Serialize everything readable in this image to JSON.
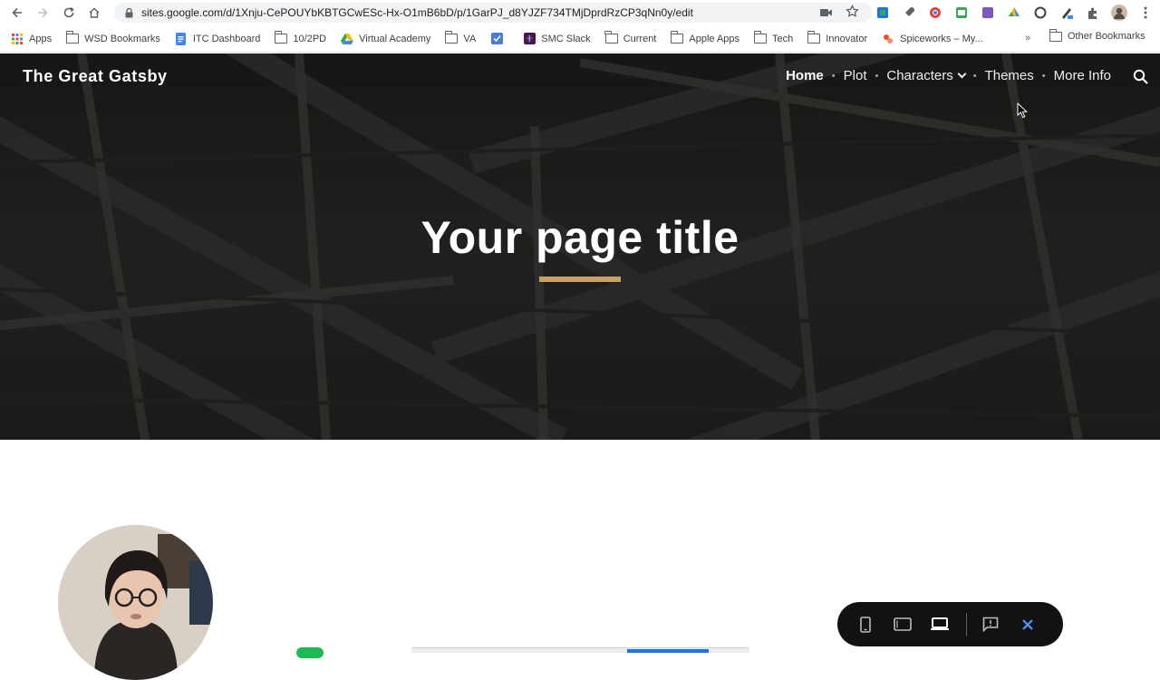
{
  "browser": {
    "url": "sites.google.com/d/1Xnju-CePOUYbKBTGCwESc-Hx-O1mB6bD/p/1GarPJ_d8YJZF734TMjDprdRzCP3qNn0y/edit",
    "bookmarks": [
      {
        "label": "Apps",
        "icon": "apps-grid-icon"
      },
      {
        "label": "WSD Bookmarks",
        "icon": "folder-icon"
      },
      {
        "label": "ITC Dashboard",
        "icon": "docs-icon"
      },
      {
        "label": "10/2PD",
        "icon": "folder-icon"
      },
      {
        "label": "Virtual Academy",
        "icon": "drive-icon"
      },
      {
        "label": "VA",
        "icon": "folder-icon"
      },
      {
        "label": "",
        "icon": "tasks-icon"
      },
      {
        "label": "SMC Slack",
        "icon": "slack-icon"
      },
      {
        "label": "Current",
        "icon": "folder-icon"
      },
      {
        "label": "Apple Apps",
        "icon": "folder-icon"
      },
      {
        "label": "Tech",
        "icon": "folder-icon"
      },
      {
        "label": "Innovator",
        "icon": "folder-icon"
      },
      {
        "label": "Spiceworks – My...",
        "icon": "spiceworks-icon"
      }
    ],
    "more_bookmarks": "»",
    "other_bookmarks": "Other Bookmarks"
  },
  "site": {
    "title": "The Great Gatsby",
    "nav": [
      {
        "label": "Home",
        "active": true
      },
      {
        "label": "Plot"
      },
      {
        "label": "Characters",
        "has_dropdown": true
      },
      {
        "label": "Themes"
      },
      {
        "label": "More Info"
      }
    ],
    "page_title": "Your page title",
    "accent_color": "#c8a167"
  },
  "preview_bar": {
    "buttons": [
      "phone-preview",
      "tablet-preview",
      "desktop-preview",
      "report-abuse",
      "close-preview"
    ]
  }
}
